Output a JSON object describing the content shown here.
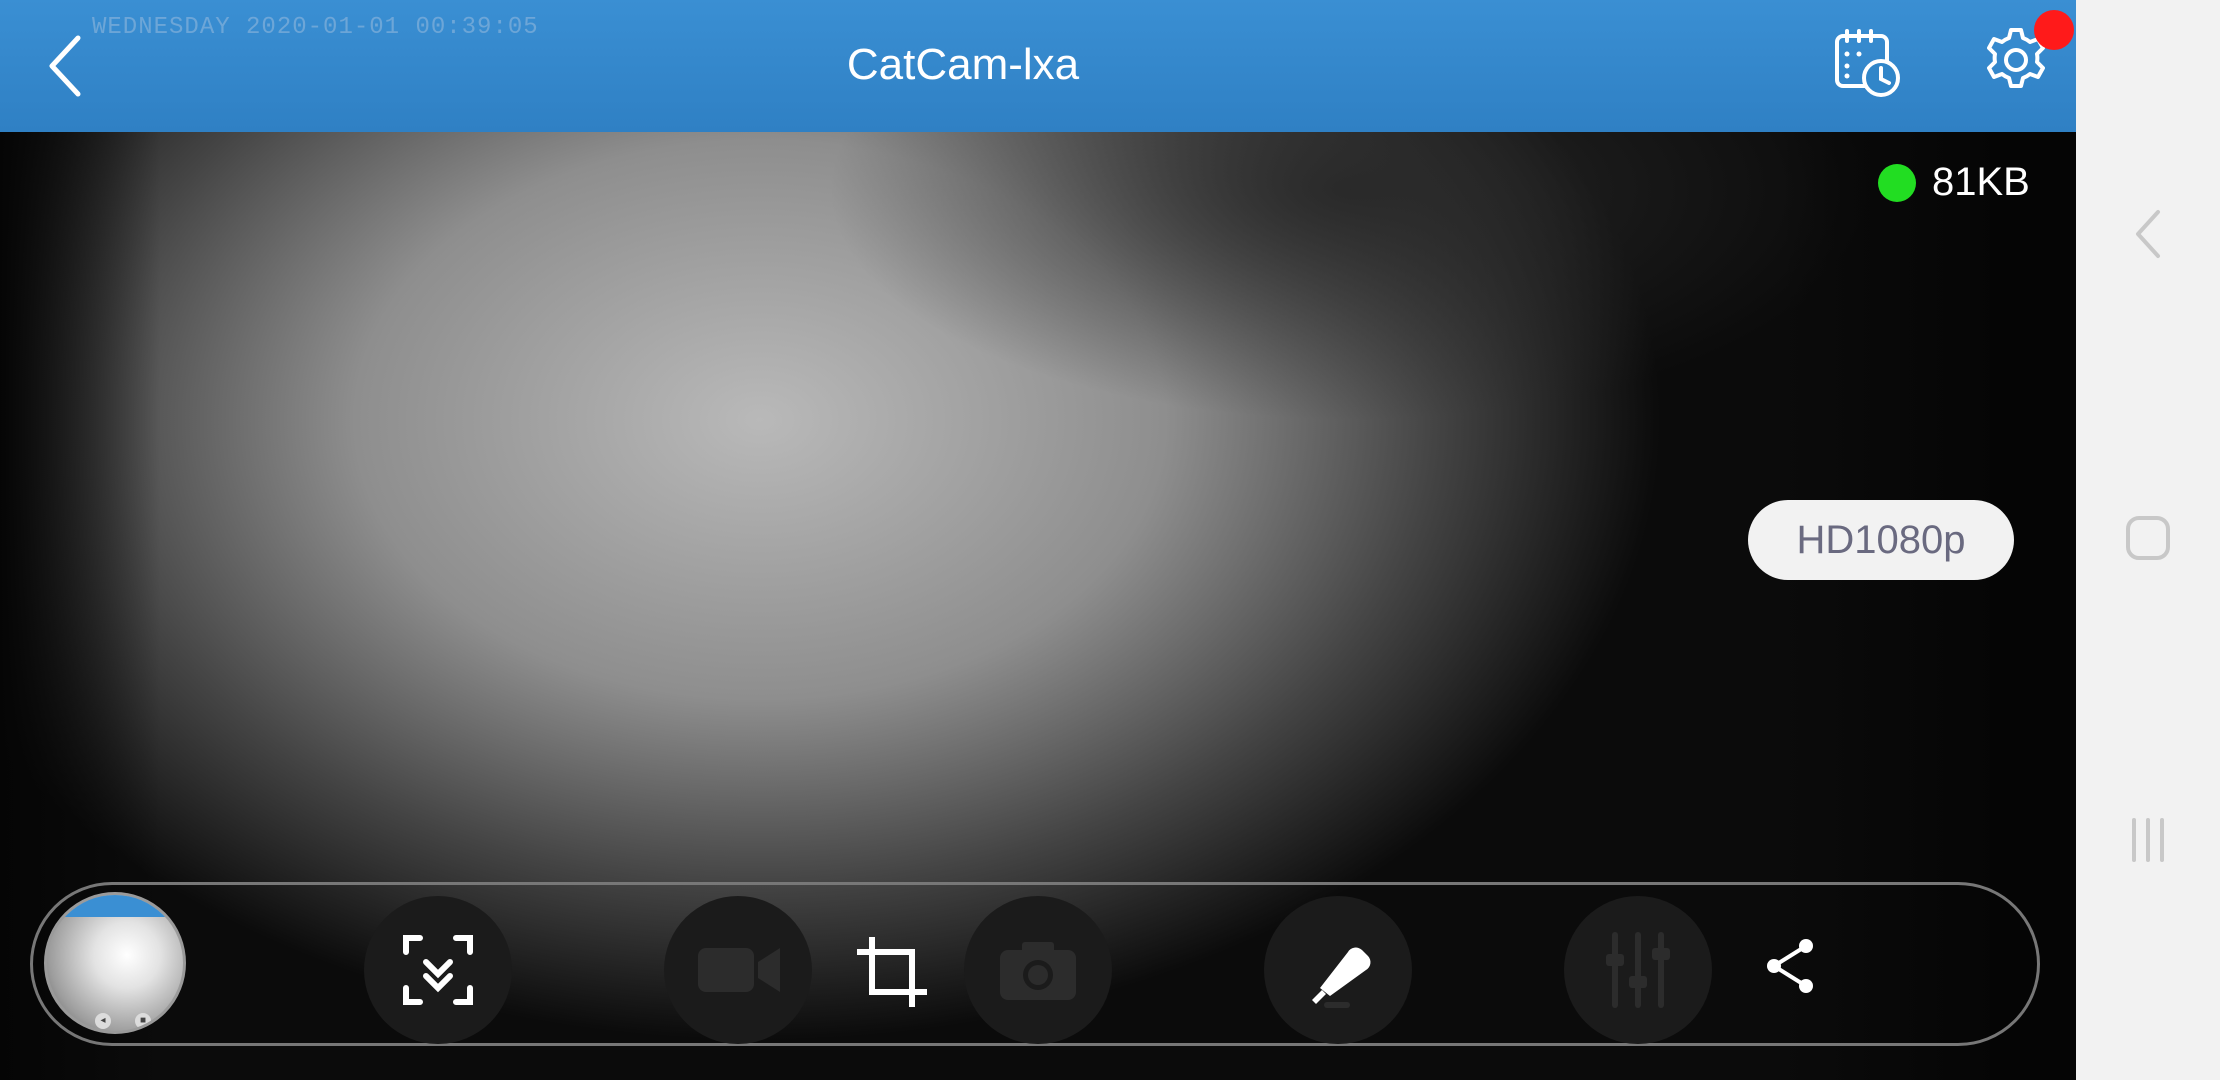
{
  "camera": {
    "name": "CatCam-lxa",
    "osd_timestamp": "WEDNESDAY 2020-01-01 00:39:05"
  },
  "stream": {
    "bitrate": "81KB",
    "resolution": "HD1080p",
    "status_color": "#22dd22"
  },
  "header": {
    "back_icon": "chevron-left-icon",
    "schedule_icon": "calendar-clock-icon",
    "settings_icon": "gear-icon",
    "notification_dot_color": "#ff1a1a"
  },
  "toolbar": {
    "items": [
      {
        "id": "preview-thumbnail"
      },
      {
        "id": "ptz-collapse",
        "icon": "chevron-double-down-icon",
        "enabled": true
      },
      {
        "id": "record",
        "icon": "video-camera-icon",
        "enabled": false
      },
      {
        "id": "crop",
        "icon": "crop-icon",
        "enabled": true
      },
      {
        "id": "snapshot",
        "icon": "camera-icon",
        "enabled": false
      },
      {
        "id": "talk",
        "icon": "microphone-icon",
        "enabled": true
      },
      {
        "id": "image-settings",
        "icon": "sliders-icon",
        "enabled": false
      },
      {
        "id": "share",
        "icon": "share-icon",
        "enabled": true
      }
    ]
  },
  "system_nav": {
    "back": "back-chevron-icon",
    "home": "home-square-icon",
    "recents": "recents-icon"
  },
  "colors": {
    "header_blue": "#2f80c4",
    "accent_red": "#ff1a1a"
  }
}
